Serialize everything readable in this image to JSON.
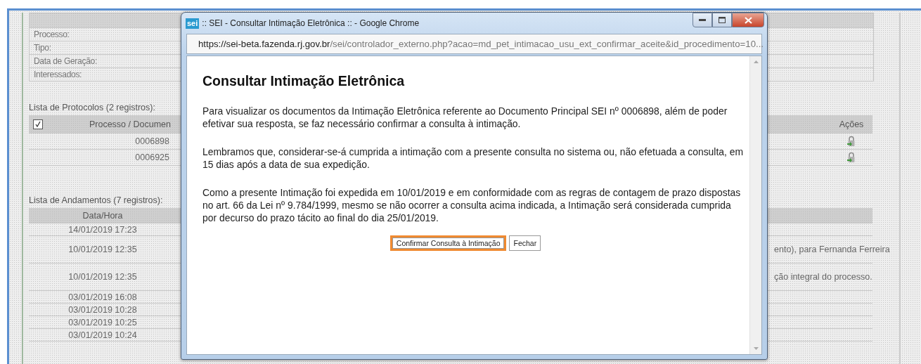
{
  "background_page": {
    "info_labels": [
      "Processo:",
      "Tipo:",
      "Data de Geração:",
      "Interessados:"
    ],
    "protocolos": {
      "title": "Lista de Protocolos (2 registros):",
      "select_all": {
        "checked": true
      },
      "columns": [
        "Processo / Documen",
        "Ações"
      ],
      "rows": [
        {
          "number": "0006898"
        },
        {
          "number": "0006925"
        }
      ]
    },
    "andamentos": {
      "title": "Lista de Andamentos (7 registros):",
      "columns": [
        "Data/Hora"
      ],
      "rows": [
        {
          "date": "14/01/2019 17:23"
        },
        {
          "date": "10/01/2019 12:35",
          "description": "ento), para Fernanda Ferreira"
        },
        {
          "date": "10/01/2019 12:35",
          "description": "ção integral do processo."
        },
        {
          "date": "03/01/2019 16:08"
        },
        {
          "date": "03/01/2019 10:28"
        },
        {
          "date": "03/01/2019 10:25"
        },
        {
          "date": "03/01/2019 10:24"
        }
      ]
    }
  },
  "popup": {
    "app_logo": "sei",
    "title": ":: SEI - Consultar Intimação Eletrônica :: - Google Chrome",
    "url_host": "https://sei-beta.fazenda.rj.gov.br",
    "url_path": "/sei/controlador_externo.php?acao=md_pet_intimacao_usu_ext_confirmar_aceite&id_procedimento=10...",
    "heading": "Consultar Intimação Eletrônica",
    "paragraphs": [
      "Para visualizar os documentos da Intimação Eletrônica referente ao Documento Principal SEI nº 0006898, além de poder efetivar sua resposta, se faz necessário confirmar a consulta à intimação.",
      "Lembramos que, considerar-se-á cumprida a intimação com a presente consulta no sistema ou, não efetuada a consulta, em 15 dias após a data de sua expedição.",
      "Como a presente Intimação foi expedida em 10/01/2019 e em conformidade com as regras de contagem de prazo dispostas no art. 66 da Lei nº 9.784/1999, mesmo se não ocorrer a consulta acima indicada, a Intimação será considerada cumprida por decurso do prazo tácito ao final do dia 25/01/2019."
    ],
    "buttons": [
      {
        "label": "Confirmar Consulta à Intimação",
        "focused": true
      },
      {
        "label": "Fechar",
        "focused": false
      }
    ]
  }
}
